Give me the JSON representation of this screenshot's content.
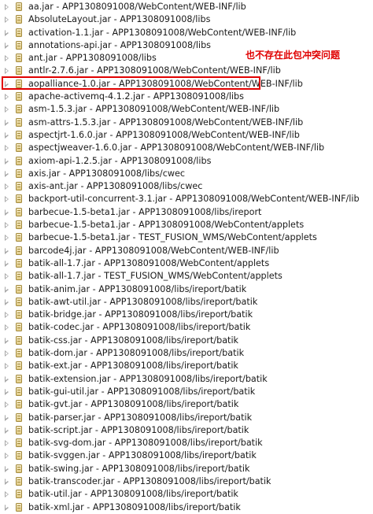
{
  "tree_items": [
    "aa.jar - APP1308091008/WebContent/WEB-INF/lib",
    "AbsoluteLayout.jar - APP1308091008/libs",
    "activation-1.1.jar - APP1308091008/WebContent/WEB-INF/lib",
    "annotations-api.jar - APP1308091008/libs",
    "ant.jar - APP1308091008/libs",
    "antlr-2.7.6.jar - APP1308091008/WebContent/WEB-INF/lib",
    "aopalliance-1.0.jar - APP1308091008/WebContent/WEB-INF/lib",
    "apache-activemq-4.1.2.jar - APP1308091008/libs",
    "asm-1.5.3.jar - APP1308091008/WebContent/WEB-INF/lib",
    "asm-attrs-1.5.3.jar - APP1308091008/WebContent/WEB-INF/lib",
    "aspectjrt-1.6.0.jar - APP1308091008/WebContent/WEB-INF/lib",
    "aspectjweaver-1.6.0.jar - APP1308091008/WebContent/WEB-INF/lib",
    "axiom-api-1.2.5.jar - APP1308091008/libs",
    "axis.jar - APP1308091008/libs/cwec",
    "axis-ant.jar - APP1308091008/libs/cwec",
    "backport-util-concurrent-3.1.jar - APP1308091008/WebContent/WEB-INF/lib",
    "barbecue-1.5-beta1.jar - APP1308091008/libs/ireport",
    "barbecue-1.5-beta1.jar - APP1308091008/WebContent/applets",
    "barbecue-1.5-beta1.jar - TEST_FUSION_WMS/WebContent/applets",
    "barcode4j.jar - APP1308091008/WebContent/WEB-INF/lib",
    "batik-all-1.7.jar - APP1308091008/WebContent/applets",
    "batik-all-1.7.jar - TEST_FUSION_WMS/WebContent/applets",
    "batik-anim.jar - APP1308091008/libs/ireport/batik",
    "batik-awt-util.jar - APP1308091008/libs/ireport/batik",
    "batik-bridge.jar - APP1308091008/libs/ireport/batik",
    "batik-codec.jar - APP1308091008/libs/ireport/batik",
    "batik-css.jar - APP1308091008/libs/ireport/batik",
    "batik-dom.jar - APP1308091008/libs/ireport/batik",
    "batik-ext.jar - APP1308091008/libs/ireport/batik",
    "batik-extension.jar - APP1308091008/libs/ireport/batik",
    "batik-gui-util.jar - APP1308091008/libs/ireport/batik",
    "batik-gvt.jar - APP1308091008/libs/ireport/batik",
    "batik-parser.jar - APP1308091008/libs/ireport/batik",
    "batik-script.jar - APP1308091008/libs/ireport/batik",
    "batik-svg-dom.jar - APP1308091008/libs/ireport/batik",
    "batik-svggen.jar - APP1308091008/libs/ireport/batik",
    "batik-swing.jar - APP1308091008/libs/ireport/batik",
    "batik-transcoder.jar - APP1308091008/libs/ireport/batik",
    "batik-util.jar - APP1308091008/libs/ireport/batik",
    "batik-xml.jar - APP1308091008/libs/ireport/batik"
  ],
  "annotation": {
    "text": "也不存在此包冲突问题",
    "color": "#e00000"
  },
  "highlight_color": "#e10000",
  "icons": {
    "expander": "collapsed-triangle-icon",
    "item": "jar-icon"
  }
}
